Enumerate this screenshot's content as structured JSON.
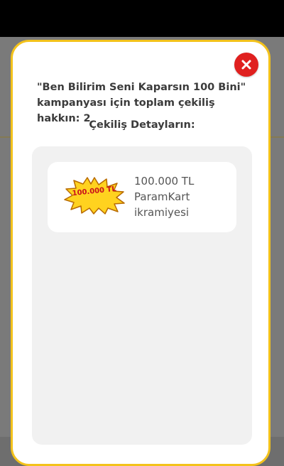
{
  "modal": {
    "close_icon": "close-icon",
    "title": "\"Ben Bilirim Seni Kaparsın 100 Bini\" kampanyası için toplam çekiliş hakkın: 2",
    "details_heading": "Çekiliş Detayların:"
  },
  "prizes": [
    {
      "badge_text": "100.000 TL",
      "badge_icon": "starburst-badge-icon",
      "line1": "100.000 TL",
      "line2": "ParamKart",
      "line3": "ikramiyesi"
    }
  ],
  "colors": {
    "accent_border": "#f3c21b",
    "close_red": "#e0201f",
    "badge_yellow": "#ffd21f",
    "badge_text_red": "#c9111b"
  }
}
